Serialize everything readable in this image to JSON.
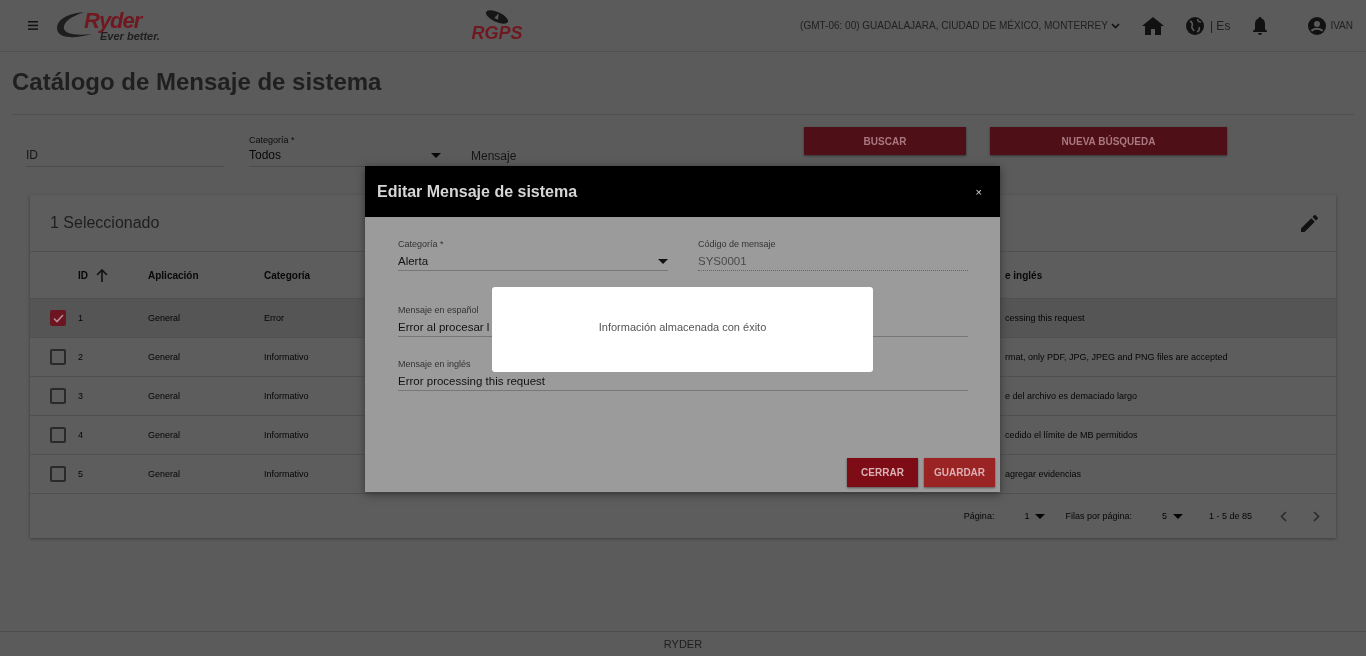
{
  "header": {
    "brand": "Ryder",
    "tagline": "Ever better.",
    "app_name": "RGPS",
    "timezone": "(GMT-06: 00) GUADALAJARA, CIUDAD DE MÉXICO, MONTERREY",
    "language": "| Es",
    "user": "IVAN"
  },
  "page": {
    "title": "Catálogo de Mensaje de sistema"
  },
  "filters": {
    "id": {
      "placeholder": "ID"
    },
    "category": {
      "label": "Categoría *",
      "value": "Todos"
    },
    "message": {
      "placeholder": "Mensaje"
    },
    "buttons": [
      "BUSCAR",
      "NUEVA BÚSQUEDA"
    ]
  },
  "table": {
    "selection_title": "1 Seleccionado",
    "columns": [
      "ID",
      "Aplicación",
      "Categoría",
      "e inglés"
    ],
    "rows": [
      {
        "selected": true,
        "id": "1",
        "application": "General",
        "category": "Error",
        "column_4": "cessing this request"
      },
      {
        "selected": false,
        "id": "2",
        "application": "General",
        "category": "Informativo",
        "column_4": "rmat, only PDF, JPG, JPEG and PNG files are accepted"
      },
      {
        "selected": false,
        "id": "3",
        "application": "General",
        "category": "Informativo",
        "column_4": "e del archivo es demaciado largo"
      },
      {
        "selected": false,
        "id": "4",
        "application": "General",
        "category": "Informativo",
        "column_4": "cedido el límite de MB permitidos"
      },
      {
        "selected": false,
        "id": "5",
        "application": "General",
        "category": "Informativo",
        "column_4": "agregar evidencias"
      }
    ]
  },
  "pagination": {
    "page_label": "Página:",
    "page": "1",
    "rows_label": "Filas por página:",
    "rows": "5",
    "range": "1 - 5 de 85"
  },
  "dialog": {
    "title": "Editar Mensaje de sistema",
    "close": "×",
    "fields": [
      {
        "kind": "select",
        "label": "Categoría *",
        "value": "Alerta"
      },
      {
        "kind": "readonly",
        "label": "Código de mensaje",
        "value": "SYS0001"
      },
      {
        "kind": "text",
        "label": "Mensaje en español",
        "value": "Error al procesar l"
      },
      {
        "kind": "text",
        "label": "Mensaje en inglés",
        "value": "Error processing this request"
      }
    ],
    "buttons": [
      "CERRAR",
      "GUARDAR"
    ]
  },
  "toast": {
    "message": "Información almacenada con éxito"
  },
  "footer": {
    "text": "RYDER"
  }
}
